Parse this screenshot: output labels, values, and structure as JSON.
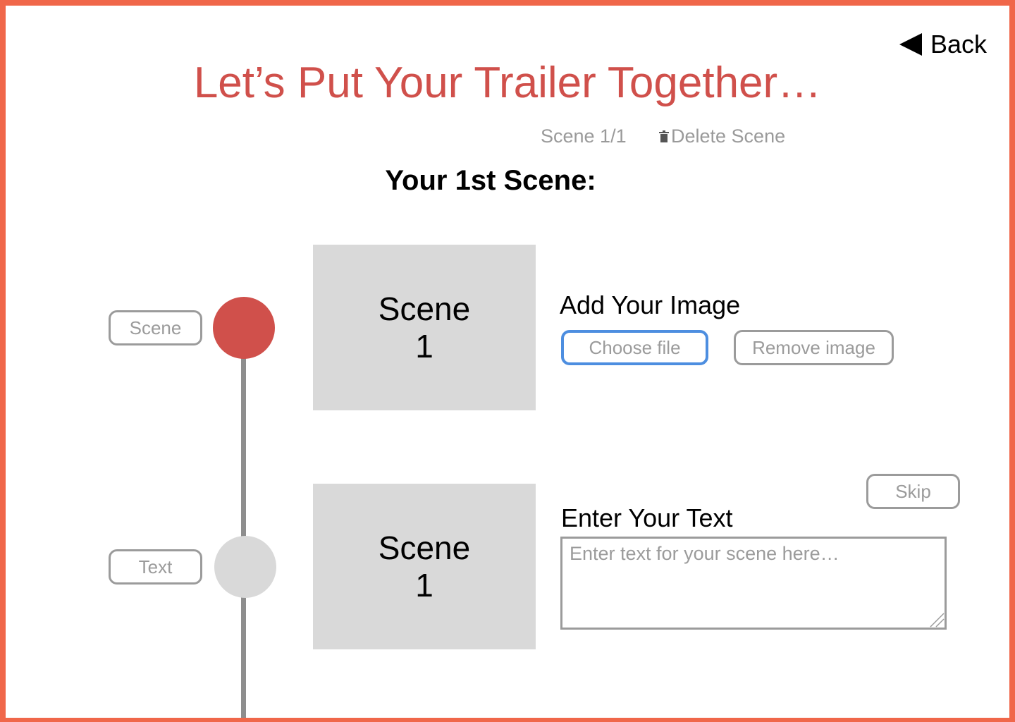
{
  "header": {
    "back_label": "Back",
    "title": "Let’s Put Your Trailer Together…",
    "scene_counter": "Scene 1/1",
    "delete_scene_label": "Delete Scene",
    "subtitle": "Your 1st Scene:"
  },
  "timeline": {
    "steps": [
      {
        "label": "Scene",
        "active": true
      },
      {
        "label": "Text",
        "active": false
      }
    ]
  },
  "image_section": {
    "preview_line1": "Scene",
    "preview_line2": "1",
    "heading": "Add Your Image",
    "choose_file_label": "Choose file",
    "remove_image_label": "Remove image"
  },
  "text_section": {
    "preview_line1": "Scene",
    "preview_line2": "1",
    "heading": "Enter Your Text",
    "skip_label": "Skip",
    "textarea_value": "",
    "textarea_placeholder": "Enter text for your scene here…"
  },
  "colors": {
    "frame_border": "#f0674a",
    "title": "#d0504b",
    "active_node": "#d0504b",
    "inactive_node": "#d9d9d9",
    "focus_outline": "#4d8ee0",
    "muted_text": "#9b9b9b"
  },
  "icons": {
    "back": "triangle-left-icon",
    "delete": "trash-icon"
  }
}
